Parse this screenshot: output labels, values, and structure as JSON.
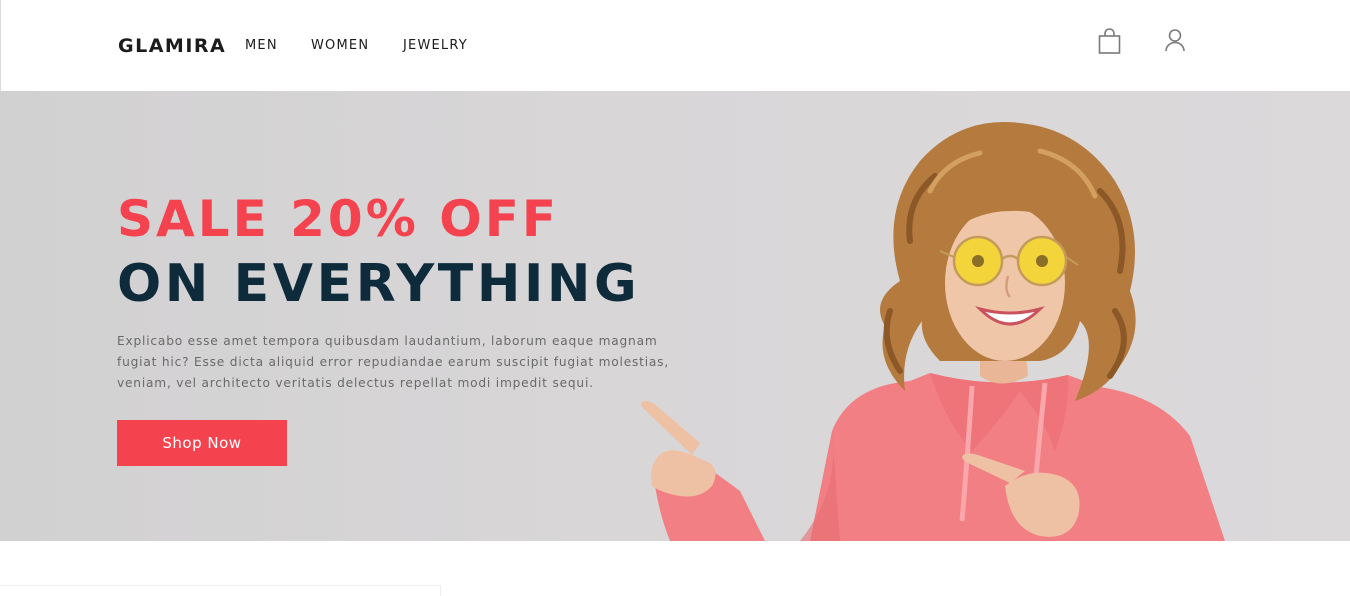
{
  "header": {
    "logo": "GLAMIRA",
    "nav": [
      "MEN",
      "WOMEN",
      "JEWELRY"
    ],
    "icons": [
      "shopping-bag-icon",
      "user-icon"
    ]
  },
  "hero": {
    "headline_line1": "SALE 20% OFF",
    "headline_line2": "ON EVERYTHING",
    "description": "Explicabo esse amet tempora quibusdam laudantium, laborum eaque magnam fugiat hic? Esse dicta aliquid error repudiandae earum suscipit fugiat molestias, veniam, vel architecto veritatis delectus repellat modi impedit sequi.",
    "cta_label": "Shop Now"
  },
  "colors": {
    "accent": "#f4434f",
    "headline_dark": "#0e2b3c",
    "hero_background": "#d8d6d7",
    "text_muted": "#6a6a6a"
  }
}
